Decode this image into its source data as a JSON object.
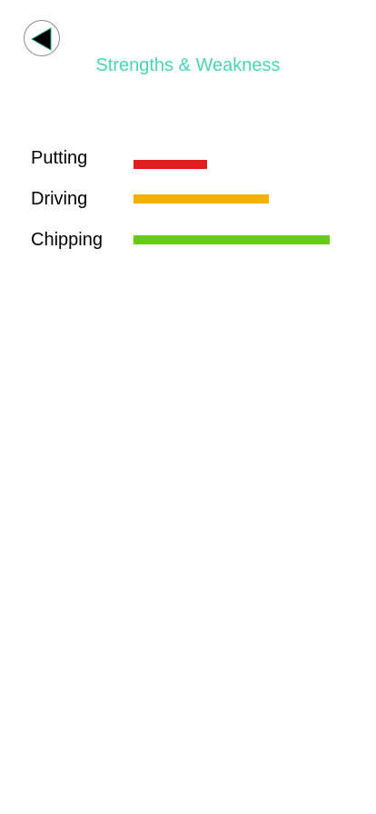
{
  "header": {
    "title": "Strengths & Weakness",
    "back_icon": "back-arrow-icon"
  },
  "colors": {
    "title": "#4ad3b5",
    "back_icon_fill": "#000000",
    "back_icon_outline": "#1fa98a",
    "putting": "#dd1f1f",
    "driving": "#f7b002",
    "chipping": "#66cc0f"
  },
  "skills": [
    {
      "label": "Putting",
      "level": 0.375,
      "color": "#dd1f1f"
    },
    {
      "label": "Driving",
      "level": 0.69,
      "color": "#f7b002"
    },
    {
      "label": "Chipping",
      "level": 1.0,
      "color": "#66cc0f"
    }
  ]
}
